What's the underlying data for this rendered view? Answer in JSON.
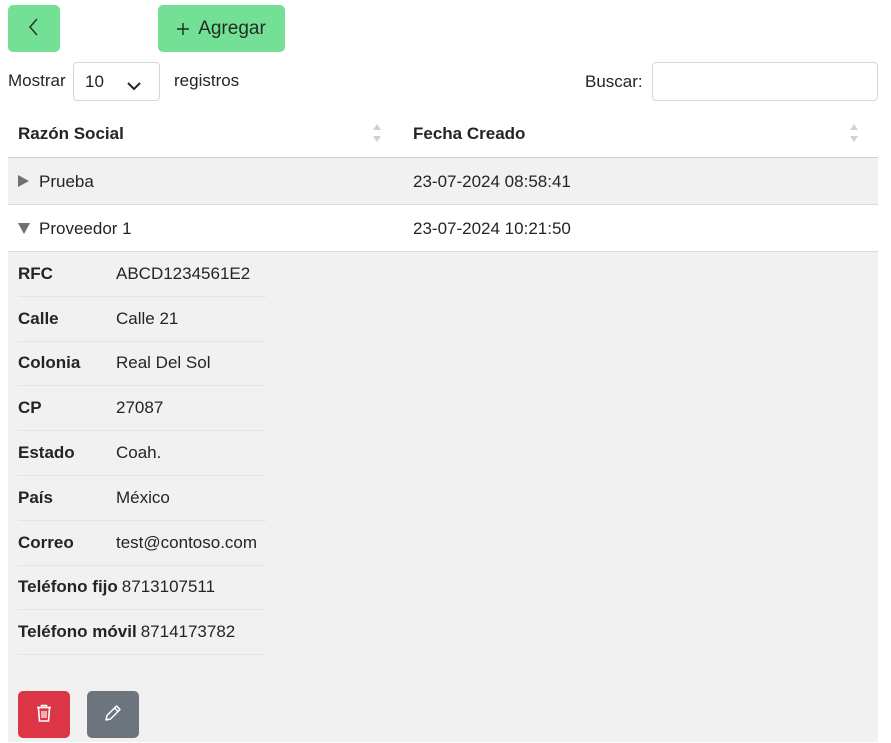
{
  "toolbar": {
    "back_icon": "chevron-left-icon",
    "add_icon": "plus-icon",
    "add_label": "Agregar"
  },
  "length": {
    "prefix": "Mostrar",
    "value": "10",
    "suffix": "registros"
  },
  "search": {
    "label": "Buscar:",
    "value": "",
    "placeholder": ""
  },
  "table": {
    "columns": [
      "Razón Social",
      "Fecha Creado"
    ],
    "rows": [
      {
        "name": "Prueba",
        "date": "23-07-2024 08:58:41",
        "expanded": false
      },
      {
        "name": "Proveedor 1",
        "date": "23-07-2024 10:21:50",
        "expanded": true
      }
    ],
    "detail": [
      {
        "label": "RFC",
        "value": "ABCD1234561E2"
      },
      {
        "label": "Calle",
        "value": "Calle 21"
      },
      {
        "label": "Colonia",
        "value": "Real Del Sol"
      },
      {
        "label": "CP",
        "value": "27087"
      },
      {
        "label": "Estado",
        "value": "Coah."
      },
      {
        "label": "País",
        "value": "México"
      },
      {
        "label": "Correo",
        "value": "test@contoso.com"
      },
      {
        "label": "Teléfono fijo",
        "value": "8713107511"
      },
      {
        "label": "Teléfono móvil",
        "value": "8714173782"
      }
    ]
  },
  "actions": {
    "delete_icon": "trash-icon",
    "edit_icon": "pencil-icon"
  },
  "colors": {
    "primary_green": "#74e095",
    "danger": "#dc3545",
    "secondary": "#6c757d",
    "row_shade": "#f1f1f1"
  }
}
